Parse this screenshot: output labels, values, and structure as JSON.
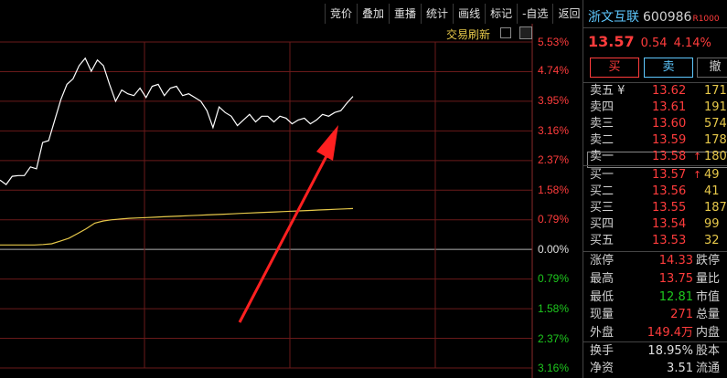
{
  "toolbar": {
    "buttons": [
      "竞价",
      "叠加",
      "重播",
      "统计",
      "画线",
      "标记",
      "-自选",
      "返回"
    ]
  },
  "chart": {
    "refresh_label": "交易刷新",
    "y_labels_up": [
      "5.53%",
      "4.74%",
      "3.95%",
      "3.16%",
      "2.37%",
      "1.58%",
      "0.79%"
    ],
    "y_label_zero": "0.00%",
    "y_labels_down": [
      "0.79%",
      "1.58%",
      "2.37%",
      "3.16%"
    ]
  },
  "chart_data": {
    "type": "line",
    "ylim": [
      -3.16,
      5.53
    ],
    "series": [
      {
        "values": [
          1.85,
          1.73,
          1.95,
          1.97,
          1.97,
          2.2,
          2.15,
          2.85,
          2.9,
          3.45,
          4.0,
          4.4,
          4.55,
          4.9,
          5.1,
          4.75,
          5.05,
          4.9,
          4.4,
          3.95,
          4.25,
          4.15,
          4.1,
          4.3,
          4.05,
          4.35,
          4.4,
          4.1,
          4.3,
          4.35,
          4.1,
          4.15,
          4.05,
          3.95,
          3.7,
          3.25,
          3.8,
          3.65,
          3.55,
          3.3,
          3.45,
          3.6,
          3.4,
          3.55,
          3.55,
          3.4,
          3.55,
          3.5,
          3.35,
          3.45,
          3.5,
          3.35,
          3.45,
          3.6,
          3.55,
          3.65,
          3.7,
          3.9,
          4.08
        ]
      },
      {
        "values": [
          0.12,
          0.12,
          0.12,
          0.12,
          0.12,
          0.13,
          0.15,
          0.22,
          0.3,
          0.42,
          0.55,
          0.7,
          0.76,
          0.79,
          0.81,
          0.83,
          0.84,
          0.85,
          0.86,
          0.87,
          0.88,
          0.89,
          0.9,
          0.91,
          0.92,
          0.93,
          0.94,
          0.95,
          0.96,
          0.97,
          0.98,
          0.99,
          1.0,
          1.01,
          1.02,
          1.03,
          1.04,
          1.05,
          1.06,
          1.07,
          1.08,
          1.09
        ]
      }
    ],
    "annotation": "red arrow"
  },
  "quote": {
    "name": "浙文互联",
    "code": "600986",
    "tag": "R1000",
    "price": "13.57",
    "change": "0.54",
    "pct": "4.14%"
  },
  "trade_buttons": {
    "buy": "买",
    "sell": "卖",
    "cancel": "撤"
  },
  "asks": [
    {
      "label": "卖五 ¥",
      "price": "13.62",
      "vol": "171"
    },
    {
      "label": "卖四",
      "price": "13.61",
      "vol": "191"
    },
    {
      "label": "卖三",
      "price": "13.60",
      "vol": "574"
    },
    {
      "label": "卖二",
      "price": "13.59",
      "vol": "178"
    },
    {
      "label": "卖一",
      "price": "13.58",
      "vol": "180"
    }
  ],
  "bids": [
    {
      "label": "买一",
      "price": "13.57",
      "vol": "49"
    },
    {
      "label": "买二",
      "price": "13.56",
      "vol": "41"
    },
    {
      "label": "买三",
      "price": "13.55",
      "vol": "187"
    },
    {
      "label": "买四",
      "price": "13.54",
      "vol": "99"
    },
    {
      "label": "买五",
      "price": "13.53",
      "vol": "32"
    }
  ],
  "stats": [
    {
      "label": "涨停",
      "value": "14.33",
      "label2": "跌停"
    },
    {
      "label": "最高",
      "value": "13.75",
      "label2": "量比"
    },
    {
      "label": "最低",
      "value": "12.81",
      "label2": "市值"
    },
    {
      "label": "现量",
      "value": "271",
      "label2": "总量"
    },
    {
      "label": "外盘",
      "value": "149.4万",
      "label2": "内盘"
    }
  ],
  "stats2": [
    {
      "label": "换手",
      "value": "18.95%",
      "label2": "股本"
    },
    {
      "label": "净资",
      "value": "3.51",
      "label2": "流通"
    }
  ],
  "colors": {
    "up": "#ff3c3c",
    "down": "#1ec81e",
    "accent": "#5ec8ff",
    "avg_line": "#e6c84a"
  }
}
